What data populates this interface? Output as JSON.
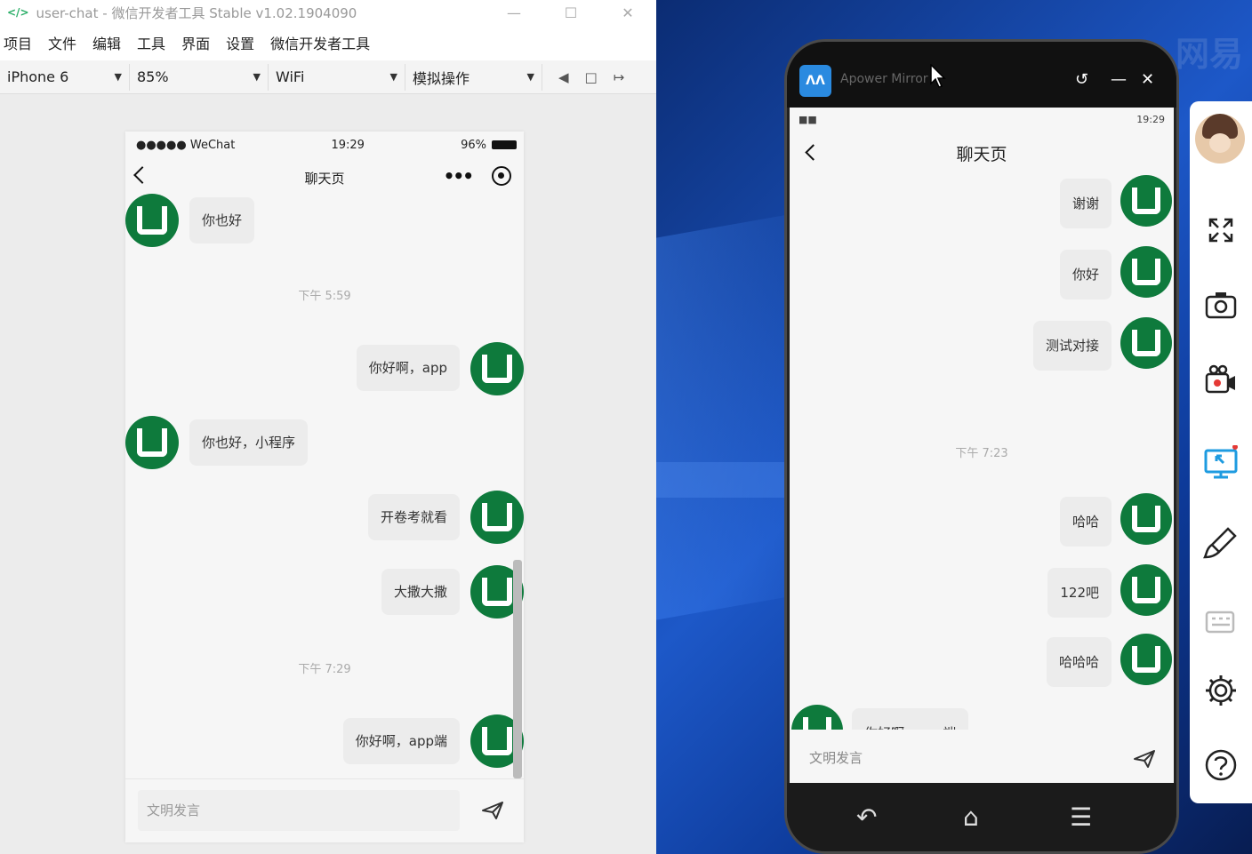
{
  "devtools": {
    "title": "user-chat - 微信开发者工具 Stable v1.02.1904090",
    "menu": [
      "项目",
      "文件",
      "编辑",
      "工具",
      "界面",
      "设置",
      "微信开发者工具"
    ],
    "toolbar": {
      "device": "iPhone 6",
      "zoom": "85%",
      "network": "WiFi",
      "operation": "模拟操作"
    }
  },
  "simulator": {
    "status": {
      "carrier": "●●●●● WeChat",
      "time": "19:29",
      "battery": "96%"
    },
    "nav_title": "聊天页",
    "messages": [
      {
        "side": "left",
        "text": "你也好"
      },
      {
        "type": "time",
        "text": "下午 5:59"
      },
      {
        "side": "right",
        "text": "你好啊，app"
      },
      {
        "side": "left",
        "text": "你也好，小程序"
      },
      {
        "side": "right",
        "text": "开卷考就看"
      },
      {
        "side": "right",
        "text": "大撒大撒"
      },
      {
        "type": "time",
        "text": "下午 7:29"
      },
      {
        "side": "right",
        "text": "你好啊，app端"
      }
    ],
    "input_placeholder": "文明发言"
  },
  "mirror": {
    "app_name": "Apower Mirror",
    "status_time": "19:29",
    "nav_title": "聊天页",
    "messages": [
      {
        "side": "right",
        "text": "谢谢"
      },
      {
        "side": "right",
        "text": "你好"
      },
      {
        "side": "right",
        "text": "测试对接"
      },
      {
        "type": "time",
        "text": "下午 7:23"
      },
      {
        "side": "right",
        "text": "哈哈"
      },
      {
        "side": "right",
        "text": "122吧"
      },
      {
        "side": "right",
        "text": "哈哈哈"
      },
      {
        "side": "left",
        "text": "你好啊，app端"
      }
    ],
    "input_placeholder": "文明发言"
  },
  "desktop": {
    "watermark": "网易"
  },
  "colors": {
    "avatar": "#0e7a3c",
    "bubble": "#ececec",
    "accent": "#2a8ae0"
  }
}
